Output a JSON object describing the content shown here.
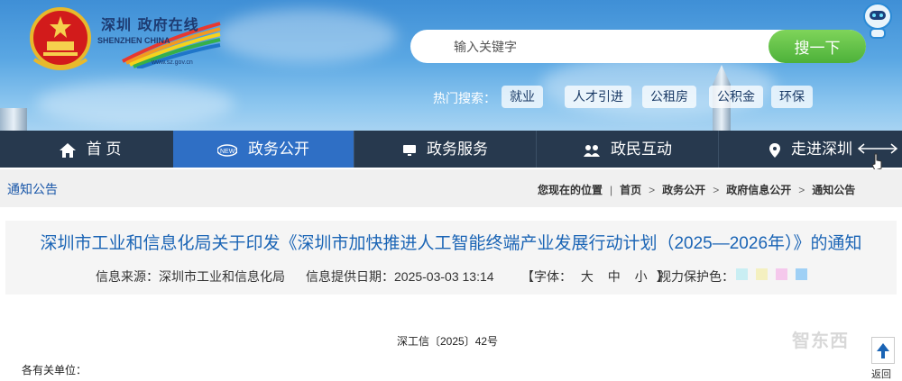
{
  "site": {
    "logo_cn": "深圳 政府在线",
    "logo_en": "SHENZHEN CHINA",
    "logo_url": "www.sz.gov.cn"
  },
  "search": {
    "placeholder": "输入关键字",
    "button": "搜一下"
  },
  "hot_search": {
    "label": "热门搜索：",
    "tags": [
      "就业",
      "人才引进",
      "公租房",
      "公积金",
      "环保"
    ]
  },
  "nav": {
    "items": [
      {
        "label": "首 页",
        "icon": "home-icon"
      },
      {
        "label": "政务公开",
        "icon": "news-icon"
      },
      {
        "label": "政务服务",
        "icon": "monitor-icon"
      },
      {
        "label": "政民互动",
        "icon": "people-icon"
      },
      {
        "label": "走进深圳",
        "icon": "pin-icon"
      }
    ],
    "active_index": 1
  },
  "breadcrumb": {
    "section_title": "通知公告",
    "location_label": "您现在的位置",
    "items": [
      "首页",
      "政务公开",
      "政府信息公开",
      "通知公告"
    ]
  },
  "article": {
    "title": "深圳市工业和信息化局关于印发《深圳市加快推进人工智能终端产业发展行动计划（2025—2026年）》的通知",
    "source_label": "信息来源：",
    "source": "深圳市工业和信息化局",
    "date_label": "信息提供日期：",
    "date": "2025-03-03 13:14",
    "font_label": "【字体：",
    "font_sizes": [
      "大",
      "中",
      "小"
    ],
    "font_end": "】",
    "vision_label": "视力保护色：",
    "vision_colors": [
      "#c9eef3",
      "#f4f0c0",
      "#f5c8ec",
      "#9fd0f5"
    ],
    "doc_number": "深工信〔2025〕42号",
    "greeting": "各有关单位："
  },
  "back_to_top": "返回",
  "watermark": "智东西",
  "colors": {
    "nav_bg": "#27394e",
    "nav_active": "#2f6fc5",
    "search_btn": "#5cbf45",
    "title_blue": "#1a64b5"
  }
}
